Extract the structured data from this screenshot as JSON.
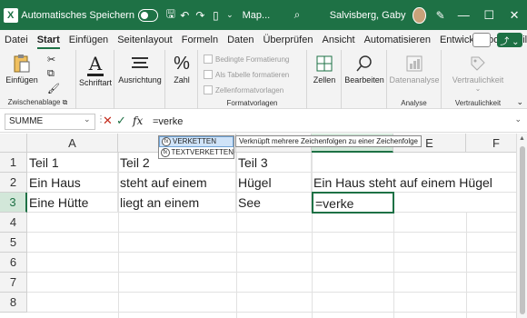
{
  "titlebar": {
    "autosave_label": "Automatisches Speichern",
    "doc_title": "Map...",
    "user_name": "Salvisberg, Gaby",
    "minimize": "—",
    "maximize": "☐",
    "close": "✕",
    "logo_letter": "X",
    "accent": "#1e7145"
  },
  "menu": {
    "tabs": [
      "Datei",
      "Start",
      "Einfügen",
      "Seitenlayout",
      "Formeln",
      "Daten",
      "Überprüfen",
      "Ansicht",
      "Automatisieren",
      "Entwicklertools",
      "Hilfe"
    ],
    "active": "Start"
  },
  "ribbon": {
    "paste_label": "Einfügen",
    "clipboard_label": "Zwischenablage",
    "font_label": "Schriftart",
    "alignment_label": "Ausrichtung",
    "number_label": "Zahl",
    "number_symbol": "%",
    "cond_format": "Bedingte Formatierung",
    "as_table": "Als Tabelle formatieren",
    "cell_styles": "Zellenformatvorlagen",
    "styles_group": "Formatvorlagen",
    "cells_label": "Zellen",
    "edit_label": "Bearbeiten",
    "data_analysis": "Datenanalyse",
    "analysis_group": "Analyse",
    "sensitivity": "Vertraulichkeit",
    "sensitivity_group": "Vertraulichkeit"
  },
  "formula_bar": {
    "name_box": "SUMME",
    "fx": "fx",
    "value": "=verke"
  },
  "autocomplete": {
    "items": [
      "VERKETTEN",
      "TEXTVERKETTEN"
    ],
    "tooltip": "Verknüpft mehrere Zeichenfolgen zu einer Zeichenfolge"
  },
  "sheet": {
    "columns": [
      "A",
      "B",
      "C",
      "D",
      "E",
      "F"
    ],
    "rows": [
      "1",
      "2",
      "3",
      "4",
      "5",
      "6",
      "7",
      "8"
    ],
    "cells": {
      "A1": "Teil 1",
      "B1": "Teil 2",
      "C1": "Teil 3",
      "A2": "Ein Haus",
      "B2": "steht auf einem",
      "C2": "Hügel",
      "D2": "Ein Haus steht auf einem Hügel",
      "A3": "Eine Hütte",
      "B3": "liegt an einem",
      "C3": "See",
      "D3": "=verke"
    }
  }
}
